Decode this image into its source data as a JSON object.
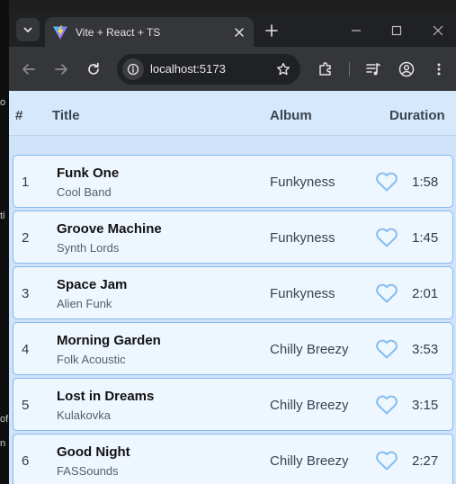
{
  "desktop": {
    "fragments": [
      "o",
      "ti",
      "of",
      "n"
    ]
  },
  "browser": {
    "tab": {
      "title": "Vite + React + TS"
    },
    "address": {
      "url": "localhost:5173"
    }
  },
  "table": {
    "headers": {
      "num": "#",
      "title": "Title",
      "album": "Album",
      "duration": "Duration"
    },
    "rows": [
      {
        "num": "1",
        "title": "Funk One",
        "artist": "Cool Band",
        "album": "Funkyness",
        "duration": "1:58"
      },
      {
        "num": "2",
        "title": "Groove Machine",
        "artist": "Synth Lords",
        "album": "Funkyness",
        "duration": "1:45"
      },
      {
        "num": "3",
        "title": "Space Jam",
        "artist": "Alien Funk",
        "album": "Funkyness",
        "duration": "2:01"
      },
      {
        "num": "4",
        "title": "Morning Garden",
        "artist": "Folk Acoustic",
        "album": "Chilly Breezy",
        "duration": "3:53"
      },
      {
        "num": "5",
        "title": "Lost in Dreams",
        "artist": "Kulakovka",
        "album": "Chilly Breezy",
        "duration": "3:15"
      },
      {
        "num": "6",
        "title": "Good Night",
        "artist": "FASSounds",
        "album": "Chilly Breezy",
        "duration": "2:27"
      }
    ]
  },
  "colors": {
    "accent": "#87b9ec",
    "heart": "#86bdf0",
    "page_bg": "#cfe3fa"
  },
  "icons": {
    "heart": "heart-outline-icon",
    "favicon": "vite-logo-icon"
  }
}
